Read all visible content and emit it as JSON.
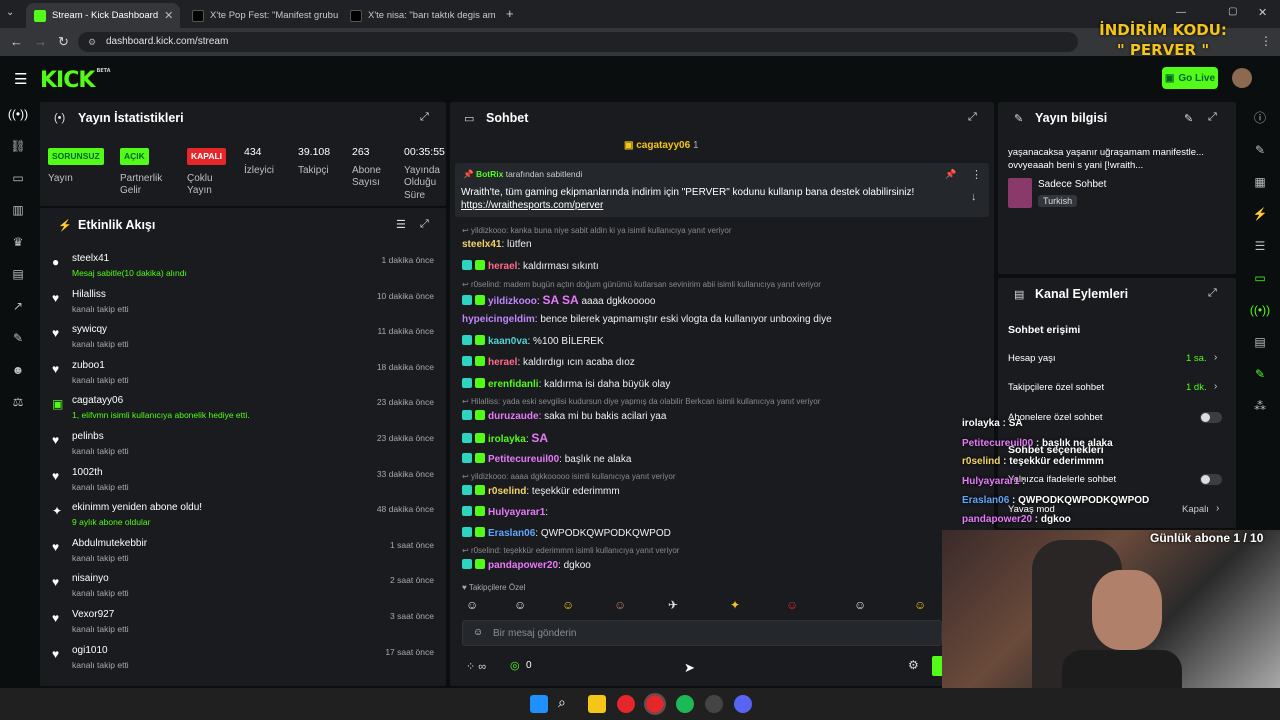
{
  "browser": {
    "tabs": [
      {
        "label": "Stream - Kick Dashboard",
        "active": true
      },
      {
        "label": "X'te Pop Fest: \"Manifest grubun",
        "active": false
      },
      {
        "label": "X'te nisa: \"barı taktık degis ami",
        "active": false
      }
    ],
    "url": "dashboard.kick.com/stream",
    "promo_line1": "İNDİRİM KODU:",
    "promo_line2": "\" PERVER \""
  },
  "header": {
    "logo": "KICK",
    "logo_tag": "BETA",
    "go_live": "Go Live"
  },
  "stats": {
    "title": "Yayın İstatistikleri",
    "items": [
      {
        "badge": "SORUNSUZ",
        "label": "Yayın",
        "color": "#53fc18"
      },
      {
        "badge": "AÇIK",
        "label": "Partnerlik Gelir Programı",
        "color": "#53fc18"
      },
      {
        "badge": "KAPALI",
        "label": "Çoklu Yayın",
        "color": "#e5262a"
      },
      {
        "value": "434",
        "label": "İzleyici"
      },
      {
        "value": "39.108",
        "label": "Takipçi"
      },
      {
        "value": "263",
        "label": "Abone Sayısı"
      },
      {
        "value": "00:35:55",
        "label": "Yayında Olduğu Süre"
      }
    ]
  },
  "activity": {
    "title": "Etkinlik Akışı",
    "items": [
      {
        "name": "steelx41",
        "sub": "Mesaj sabitle(10 dakika) alındı",
        "time": "1 dakika önce",
        "icon": "pin",
        "green": true
      },
      {
        "name": "Hilalliss",
        "sub": "kanalı takip etti",
        "time": "10 dakika önce",
        "icon": "heart"
      },
      {
        "name": "sywicqy",
        "sub": "kanalı takip etti",
        "time": "11 dakika önce",
        "icon": "heart"
      },
      {
        "name": "zuboo1",
        "sub": "kanalı takip etti",
        "time": "18 dakika önce",
        "icon": "heart"
      },
      {
        "name": "cagatayy06",
        "sub": "1, elifvmn isimli kullanıcıya abonelik hediye etti.",
        "time": "23 dakika önce",
        "icon": "gift",
        "green": true
      },
      {
        "name": "pelinbs",
        "sub": "kanalı takip etti",
        "time": "23 dakika önce",
        "icon": "heart"
      },
      {
        "name": "1002th",
        "sub": "kanalı takip etti",
        "time": "33 dakika önce",
        "icon": "heart"
      },
      {
        "name": "ekinimm yeniden abone oldu!",
        "sub": "9 aylık abone oldular",
        "time": "48 dakika önce",
        "icon": "star",
        "green": true
      },
      {
        "name": "Abdulmutekebbir",
        "sub": "kanalı takip etti",
        "time": "1 saat önce",
        "icon": "heart"
      },
      {
        "name": "nisainyo",
        "sub": "kanalı takip etti",
        "time": "2 saat önce",
        "icon": "heart"
      },
      {
        "name": "Vexor927",
        "sub": "kanalı takip etti",
        "time": "3 saat önce",
        "icon": "heart"
      },
      {
        "name": "ogi1010",
        "sub": "kanalı takip etti",
        "time": "17 saat önce",
        "icon": "heart"
      }
    ]
  },
  "chat": {
    "title": "Sohbet",
    "top_gifter": "cagatayy06",
    "top_gifter_count": "1",
    "pinned_by": "BotRix",
    "pinned_by_suffix": "tarafından sabitlendi",
    "pinned_text": "Wraith'te, tüm gaming ekipmanlarında indirim için \"PERVER\" kodunu kullanıp bana destek olabilirsiniz!",
    "pinned_link": "https://wraithesports.com/perver",
    "messages": [
      {
        "reply": "yildizkooo: kanka buna niye sabit aldin ki ya isimli kullanıcıya yanıt veriyor"
      },
      {
        "user": "steelx41",
        "color": "#f5d36b",
        "text": "lütfen"
      },
      {
        "user": "herael",
        "color": "#ff6b8a",
        "text": "kaldırması sıkıntı"
      },
      {
        "reply": "r0selind: madem bugün açtın doğum günümü kutlarsan sevinirim abii isimli kullanıcıya yanıt veriyor"
      },
      {
        "user": "yildizkooo",
        "color": "#c084fc",
        "text": "aaaa dgkkooooo",
        "emote": "SA SA"
      },
      {
        "user": "hypeicingeldim",
        "color": "#c084fc",
        "text": "bence bilerek yapmamıştır eski vlogta da kullanıyor unboxing diye"
      },
      {
        "user": "kaan0va",
        "color": "#53d3d1",
        "text": "%100 BİLEREK"
      },
      {
        "user": "herael",
        "color": "#ff6b8a",
        "text": "kaldırdıgı ıcın acaba dıoz"
      },
      {
        "user": "erenfidanli",
        "color": "#53fc18",
        "text": "kaldırma isi daha büyük olay"
      },
      {
        "reply": "Hilalliss: yada eski sevgilisi kudursun diye yapmış da olabilir Berkcan isimli kullanıcıya yanıt veriyor"
      },
      {
        "user": "duruzaude",
        "color": "#e879f9",
        "text": "saka mi bu bakis acilari yaa"
      },
      {
        "user": "irolayka",
        "color": "#53fc18",
        "text": "",
        "emote": "SA"
      },
      {
        "user": "Petitecureuil00",
        "color": "#e879f9",
        "text": "başlık ne alaka"
      },
      {
        "reply": "yildizkooo: aaaa dgkkooooo isimli kullanıcıya yanıt veriyor"
      },
      {
        "user": "r0selind",
        "color": "#f5d36b",
        "text": "teşekkür ederimmm"
      },
      {
        "user": "Hulyayarar1",
        "color": "#e879f9",
        "text": ""
      },
      {
        "user": "Eraslan06",
        "color": "#60a5fa",
        "text": "QWPODKQWPODKQWPOD"
      },
      {
        "reply": "r0selind: teşekkür ederimmm isimli kullanıcıya yanıt veriyor"
      },
      {
        "user": "pandapower20",
        "color": "#e879f9",
        "text": "dgkoo"
      }
    ],
    "followers_only": "Takipçilere Özel",
    "input_placeholder": "Bir mesaj gönderin",
    "points": "0"
  },
  "info": {
    "title": "Yayın bilgisi",
    "stream_title": "yaşanacaksa yaşanır uğraşamam manifestle... ovvyeaaah beni s yani [!wraith...",
    "category": "Sadece Sohbet",
    "language": "Turkish"
  },
  "actions": {
    "title": "Kanal Eylemleri",
    "chat_access": "Sohbet erişimi",
    "account_age": "Hesap yaşı",
    "account_age_value": "1 sa.",
    "followers_chat": "Takipçilere özel sohbet",
    "followers_chat_value": "1 dk.",
    "subs_chat": "Abonelere özel sohbet",
    "chat_options": "Sohbet seçenekleri",
    "emote_only": "Yalnızca ifadelerle sohbet",
    "slow_mode": "Yavaş mod",
    "slow_mode_value": "Kapalı"
  },
  "overlay": {
    "chat": [
      {
        "user": "duruzaude",
        "text": "saka mi bu bakis acilari yaa",
        "color": "#e879f9"
      },
      {
        "user": "irolayka",
        "text": "SA",
        "color": "#fff"
      },
      {
        "user": "Petitecureuil00",
        "text": "başlık ne alaka",
        "color": "#e879f9"
      },
      {
        "user": "r0selind",
        "text": "teşekkür ederimmm",
        "color": "#f5d36b"
      },
      {
        "user": "Hulyayarar1",
        "text": "",
        "color": "#e879f9"
      },
      {
        "user": "Eraslan06",
        "text": "QWPODKQWPODKQWPOD",
        "color": "#60a5fa"
      },
      {
        "user": "pandapower20",
        "text": "dgkoo",
        "color": "#e879f9"
      }
    ],
    "sub_goal": "Günlük abone 1 / 10"
  }
}
